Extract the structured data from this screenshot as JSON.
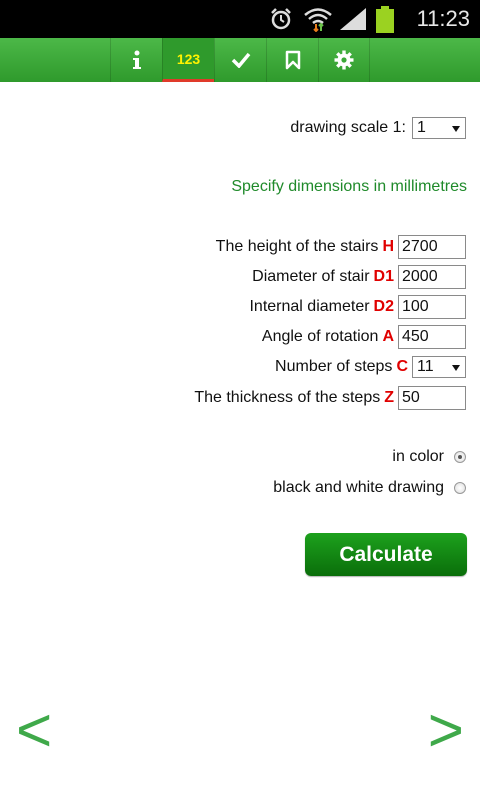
{
  "status_bar": {
    "time": "11:23",
    "icons": [
      "alarm-icon",
      "wifi-icon",
      "signal-icon",
      "battery-icon"
    ]
  },
  "tabs": [
    {
      "name": "info",
      "label": "i",
      "icon": "info-icon"
    },
    {
      "name": "params",
      "label": "123",
      "icon": "numbers-icon",
      "active": true
    },
    {
      "name": "check",
      "label": "",
      "icon": "check-icon"
    },
    {
      "name": "bookmark",
      "label": "",
      "icon": "bookmark-icon"
    },
    {
      "name": "settings",
      "label": "",
      "icon": "gear-icon"
    }
  ],
  "scale": {
    "label": "drawing scale 1:",
    "value": "1"
  },
  "hint": "Specify dimensions in millimetres",
  "fields": {
    "height": {
      "label": "The height of the stairs",
      "var": "H",
      "value": "2700"
    },
    "diameter": {
      "label": "Diameter of stair",
      "var": "D1",
      "value": "2000"
    },
    "internal": {
      "label": "Internal diameter",
      "var": "D2",
      "value": "100"
    },
    "angle": {
      "label": "Angle of rotation",
      "var": "A",
      "value": "450"
    },
    "steps": {
      "label": "Number of steps",
      "var": "C",
      "value": "11"
    },
    "thickness": {
      "label": "The thickness of the steps",
      "var": "Z",
      "value": "50"
    }
  },
  "options": {
    "color": {
      "label": "in color",
      "checked": true
    },
    "bw": {
      "label": "black and white drawing",
      "checked": false
    }
  },
  "calculate_label": "Calculate",
  "nav": {
    "prev": "<",
    "next": ">"
  },
  "colors": {
    "accent": "#3fa94a",
    "variable": "#e00000",
    "hint": "#1f8a2a",
    "button": "#0a7d0a"
  }
}
